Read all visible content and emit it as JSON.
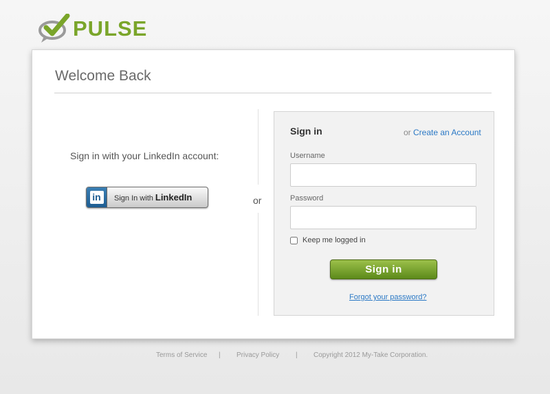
{
  "brand": {
    "name": "PULSE"
  },
  "card": {
    "title": "Welcome Back"
  },
  "linkedin": {
    "prompt": "Sign in with your LinkedIn account:",
    "logo": "in",
    "button_prefix": "Sign In with",
    "button_brand": "LinkedIn"
  },
  "divider": {
    "or": "or"
  },
  "signin": {
    "title": "Sign in",
    "or_prefix": "or",
    "create_account": "Create an Account",
    "username_label": "Username",
    "username_value": "",
    "password_label": "Password",
    "password_value": "",
    "keep_logged_in": "Keep me logged in",
    "keep_checked": false,
    "button": "Sign in",
    "forgot": "Forgot your password?"
  },
  "footer": {
    "terms": "Terms of Service",
    "sep1": "|",
    "privacy": "Privacy Policy",
    "sep2": "|",
    "copyright": "Copyright 2012 My-Take Corporation."
  },
  "colors": {
    "brand_green": "#7aa52a",
    "link_blue": "#2a78c5",
    "linkedin_blue": "#1e5d92"
  }
}
